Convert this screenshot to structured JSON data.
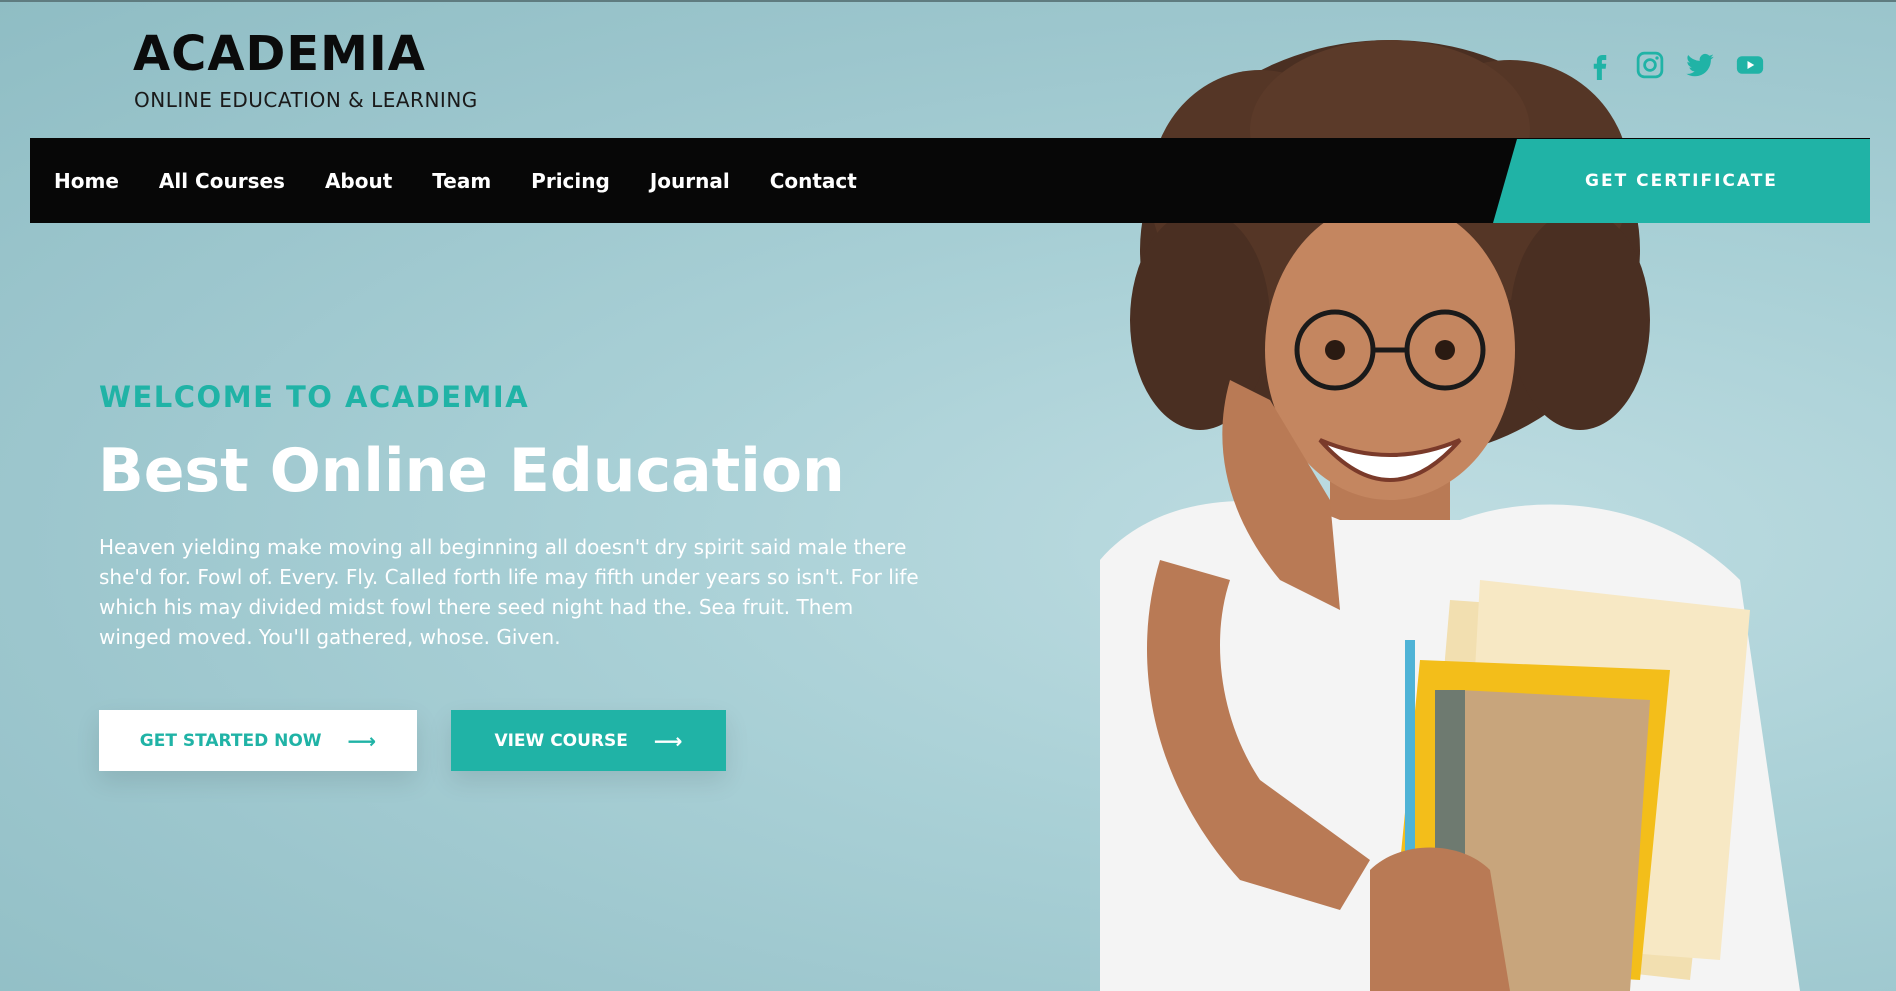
{
  "brand": {
    "title": "ACADEMIA",
    "subtitle": "ONLINE EDUCATION & LEARNING"
  },
  "social": [
    {
      "icon": "facebook-icon"
    },
    {
      "icon": "instagram-icon"
    },
    {
      "icon": "twitter-icon"
    },
    {
      "icon": "youtube-icon"
    }
  ],
  "nav": {
    "items": [
      {
        "label": "Home"
      },
      {
        "label": "All Courses"
      },
      {
        "label": "About"
      },
      {
        "label": "Team"
      },
      {
        "label": "Pricing"
      },
      {
        "label": "Journal"
      },
      {
        "label": "Contact"
      }
    ],
    "cta_label": "GET CERTIFICATE"
  },
  "hero": {
    "eyebrow": "WELCOME TO ACADEMIA",
    "headline": "Best Online Education",
    "description": "Heaven yielding make moving all beginning all doesn't dry spirit said male there she'd for. Fowl of. Every. Fly. Called forth life may fifth under years so isn't. For life which his may divided midst fowl there seed night had the. Sea fruit. Them winged moved. You'll gathered, whose. Given.",
    "primary_button": "GET STARTED NOW",
    "secondary_button": "VIEW COURSE",
    "arrow": "⟶"
  },
  "colors": {
    "accent": "#20b3a6",
    "nav_bg": "#070707",
    "background": "#a9d0d6"
  }
}
